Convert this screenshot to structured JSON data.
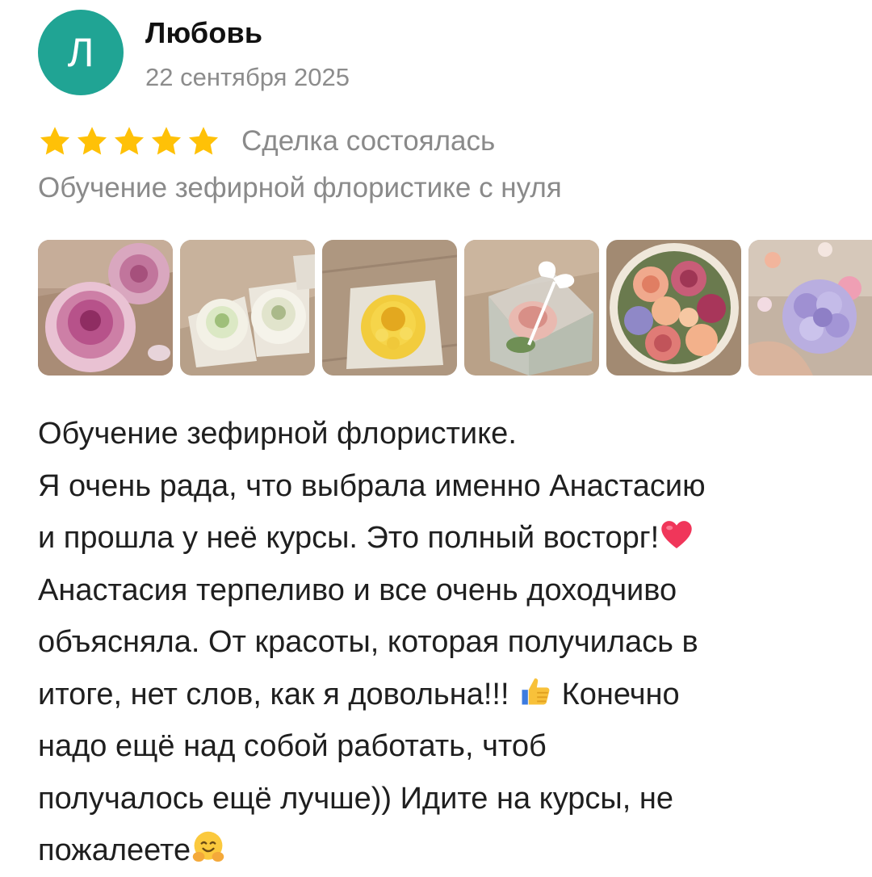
{
  "review": {
    "author": {
      "initial": "Л",
      "name": "Любовь",
      "avatar_color": "#20a494"
    },
    "date": "22 сентября 2025",
    "rating": {
      "stars": 5,
      "max": 5,
      "star_color": "#ffc107"
    },
    "deal_status": "Сделка состоялась",
    "item_title": "Обучение зефирной флористике с нуля",
    "photos": [
      {
        "icon": "pink-peony-photo"
      },
      {
        "icon": "white-roses-photo"
      },
      {
        "icon": "yellow-chrysanthemum-photo"
      },
      {
        "icon": "gift-box-rose-photo"
      },
      {
        "icon": "flower-box-bouquet-photo"
      },
      {
        "icon": "lilac-hydrangea-photo"
      }
    ],
    "text_lines": [
      "Обучение зефирной флористике.",
      "Я очень рада,  что выбрала именно Анастасию",
      "и прошла у неё курсы. Это полный восторг!",
      "Анастасия терпеливо и все очень доходчиво",
      "объясняла. От красоты, которая получилась в",
      "итоге, нет слов, как я довольна!!! ",
      "надо ещё над собой работать,  чтоб",
      "получалось ещё лучше)) Идите на курсы, не",
      "пожалеете"
    ],
    "text_line6_after_emoji": " Конечно",
    "emojis": {
      "line3": "red-heart-emoji",
      "line6": "thumbs-up-emoji",
      "line9": "hugging-face-emoji"
    }
  }
}
